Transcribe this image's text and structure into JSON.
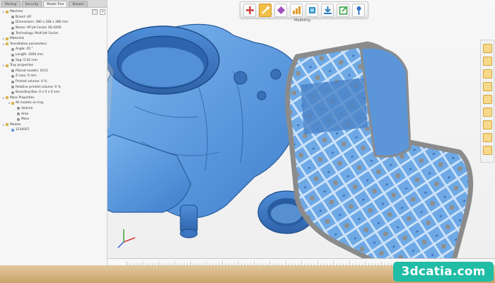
{
  "tabs": [
    {
      "label": "Markup",
      "active": false
    },
    {
      "label": "Security",
      "active": false
    },
    {
      "label": "Model Tree",
      "active": true
    },
    {
      "label": "Browse",
      "active": false
    }
  ],
  "tree": [
    {
      "label": "Machine",
      "indent": 0,
      "twisty": "▾",
      "icon": "folder"
    },
    {
      "label": "Brand: HP",
      "indent": 1,
      "twisty": "",
      "icon": "dot"
    },
    {
      "label": "Dimensions: 380 x 284 x 380 mm",
      "indent": 1,
      "twisty": "",
      "icon": "dot"
    },
    {
      "label": "Name: HP Jet Fusion 3D 4200",
      "indent": 1,
      "twisty": "",
      "icon": "dot"
    },
    {
      "label": "Technology: Multi Jet Fusion",
      "indent": 1,
      "twisty": "",
      "icon": "dot"
    },
    {
      "label": "Materials",
      "indent": 0,
      "twisty": "▸",
      "icon": "folder"
    },
    {
      "label": "Tessellation parameters",
      "indent": 0,
      "twisty": "▾",
      "icon": "folder"
    },
    {
      "label": "Angle: 45 °",
      "indent": 1,
      "twisty": "",
      "icon": "dot"
    },
    {
      "label": "Length: 1000 mm",
      "indent": 1,
      "twisty": "",
      "icon": "dot"
    },
    {
      "label": "Sag: 0.02 mm",
      "indent": 1,
      "twisty": "",
      "icon": "dot"
    },
    {
      "label": "Tray properties",
      "indent": 0,
      "twisty": "▾",
      "icon": "folder"
    },
    {
      "label": "Placed models: 0/1/1",
      "indent": 1,
      "twisty": "",
      "icon": "dot"
    },
    {
      "label": "Z max: 0 mm",
      "indent": 1,
      "twisty": "",
      "icon": "dot"
    },
    {
      "label": "Printed volume: 0 %",
      "indent": 1,
      "twisty": "",
      "icon": "dot"
    },
    {
      "label": "Relative printed volume: 0 %",
      "indent": 1,
      "twisty": "",
      "icon": "dot"
    },
    {
      "label": "Bounding Box: 0 x 0 x 0 mm",
      "indent": 1,
      "twisty": "",
      "icon": "dot"
    },
    {
      "label": "Mass Properties",
      "indent": 0,
      "twisty": "▾",
      "icon": "folder"
    },
    {
      "label": "All models on tray",
      "indent": 1,
      "twisty": "▾",
      "icon": "folder"
    },
    {
      "label": "Volume",
      "indent": 2,
      "twisty": "",
      "icon": "dot"
    },
    {
      "label": "Area",
      "indent": 2,
      "twisty": "",
      "icon": "dot"
    },
    {
      "label": "Mass",
      "indent": 2,
      "twisty": "",
      "icon": "dot"
    },
    {
      "label": "Models",
      "indent": 0,
      "twisty": "▾",
      "icon": "folder"
    },
    {
      "label": "1234567",
      "indent": 1,
      "twisty": "",
      "icon": "part"
    }
  ],
  "toolbar": {
    "buttons": [
      {
        "icon": "add-icon",
        "active": false
      },
      {
        "icon": "magic-tool-icon",
        "active": true
      },
      {
        "icon": "transform-icon",
        "active": false
      },
      {
        "icon": "chart-icon",
        "active": false
      },
      {
        "icon": "layers-icon",
        "active": false
      },
      {
        "icon": "download-icon",
        "active": false
      },
      {
        "icon": "export-icon",
        "active": false
      },
      {
        "icon": "pin-icon",
        "active": false
      }
    ],
    "caption": "Modeling"
  },
  "right_toolbar": {
    "count": 9
  },
  "watermark": "3dcatia.com",
  "colors": {
    "model": "#5b9be0",
    "model_dark": "#3a78c4",
    "lattice_gray": "#9a9a9a",
    "accent": "#f2c04a",
    "watermark_bg": "#20bca6"
  }
}
